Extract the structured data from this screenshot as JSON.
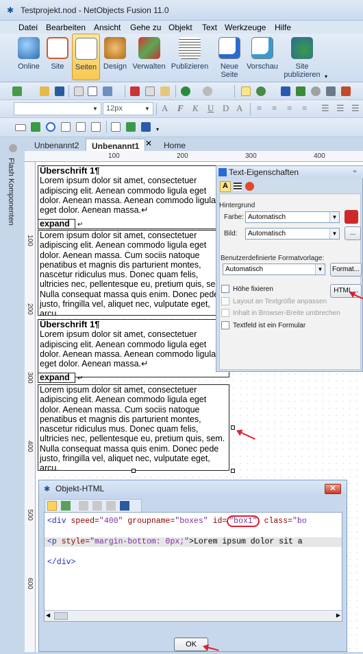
{
  "window": {
    "title": "Testprojekt.nod - NetObjects Fusion 11.0"
  },
  "menu": [
    "Datei",
    "Bearbeiten",
    "Ansicht",
    "Gehe zu",
    "Objekt",
    "Text",
    "Werkzeuge",
    "Hilfe"
  ],
  "ribbon": [
    {
      "label": "Online",
      "icon": "globe-icon",
      "color": "#3a78b5"
    },
    {
      "label": "Site",
      "icon": "sitemap-icon",
      "color": "#d05a2a"
    },
    {
      "label": "Seiten",
      "icon": "pencil-page-icon",
      "color": "#e0a51a",
      "active": true
    },
    {
      "label": "Design",
      "icon": "palette-icon",
      "color": "#c8832a"
    },
    {
      "label": "Verwalten",
      "icon": "boxes-icon",
      "color": "#c43a2a"
    },
    {
      "label": "Publizieren",
      "icon": "pages-icon",
      "color": "#4a4a4a"
    },
    {
      "label": "Neue\nSeite",
      "icon": "new-page-icon",
      "color": "#2a6ad0"
    },
    {
      "label": "Vorschau",
      "icon": "preview-icon",
      "color": "#3a9ad0"
    },
    {
      "label": "Site\npublizieren",
      "icon": "publish-site-icon",
      "color": "#2a8a3a"
    }
  ],
  "format_bar": {
    "font_size": "12px"
  },
  "tabs": [
    "Unbenannt2",
    "Unbenannt1",
    "Home"
  ],
  "sidebar": {
    "label": "Flash Komponenten"
  },
  "ruler": {
    "h": [
      "100",
      "200",
      "300",
      "400"
    ],
    "v": [
      "100",
      "200",
      "300",
      "400",
      "500",
      "600"
    ]
  },
  "content": {
    "heading1": "Überschrift 1¶",
    "short_text": "Lorem ipsum dolor sit amet, consectetuer adipiscing elit. Aenean commodo ligula eget dolor. Aenean massa. Aenean commodo ligula eget dolor. Aenean massa.↵",
    "expand": "expand",
    "expand_mark": "↵",
    "long_text": "Lorem ipsum dolor sit amet, consectetuer adipiscing elit. Aenean commodo ligula eget dolor. Aenean massa. Cum sociis natoque penatibus et magnis dis parturient montes, nascetur ridiculus mus. Donec quam felis, ultricies nec, pellentesque eu, pretium quis, sem. Nulla consequat massa quis enim. Donec pede justo, fringilla vel, aliquet nec, vulputate eget, arcu.",
    "heading2": "Überschrift 1¶",
    "short_text2": "Lorem ipsum dolor sit amet, consectetuer adipiscing elit. Aenean commodo ligula eget dolor. Aenean massa. Aenean commodo ligula eget dolor. Aenean massa.↵",
    "long_text2": "Lorem ipsum dolor sit amet, consectetuer adipiscing elit. Aenean commodo ligula eget dolor. Aenean massa. Cum sociis natoque penatibus et magnis dis parturient montes, nascetur ridiculus mus. Donec quam felis, ultricies nec, pellentesque eu, pretium quis, sem. Nulla consequat massa quis enim. Donec pede justo, fringilla vel, aliquet nec, vulputate eget, arcu."
  },
  "props": {
    "title": "Text-Eigenschaften",
    "group_bg": "Hintergrund",
    "farbe_label": "Farbe:",
    "farbe_value": "Automatisch",
    "bild_label": "Bild:",
    "bild_value": "Automatisch",
    "bild_btn": "...",
    "format_label": "Benutzerdefinierte Formatvorlage:",
    "format_value": "Automatisch",
    "format_btn": "Format...",
    "html_btn": "HTML...",
    "cb1": "Höhe fixieren",
    "cb2": "Layout an Textgröße anpassen",
    "cb3": "Inhalt in Browser-Breite umbrechen",
    "cb4": "Textfeld ist ein Formular"
  },
  "dialog": {
    "title": "Objekt-HTML",
    "line1_tag": "<div",
    "line1_a1": " speed=",
    "line1_v1": "\"400\"",
    "line1_a2": " groupname=",
    "line1_v2": "\"boxes\"",
    "line1_a3": " id=",
    "line1_v3": "\"box1\"",
    "line1_a4": " class=",
    "line1_v4": "\"bo",
    "line2_tag": "<p",
    "line2_a1": " style=",
    "line2_v1": "\"margin-bottom: 0px;\"",
    "line2_rest": ">Lorem ipsum dolor sit a",
    "line3": "</div>",
    "ok": "OK"
  }
}
